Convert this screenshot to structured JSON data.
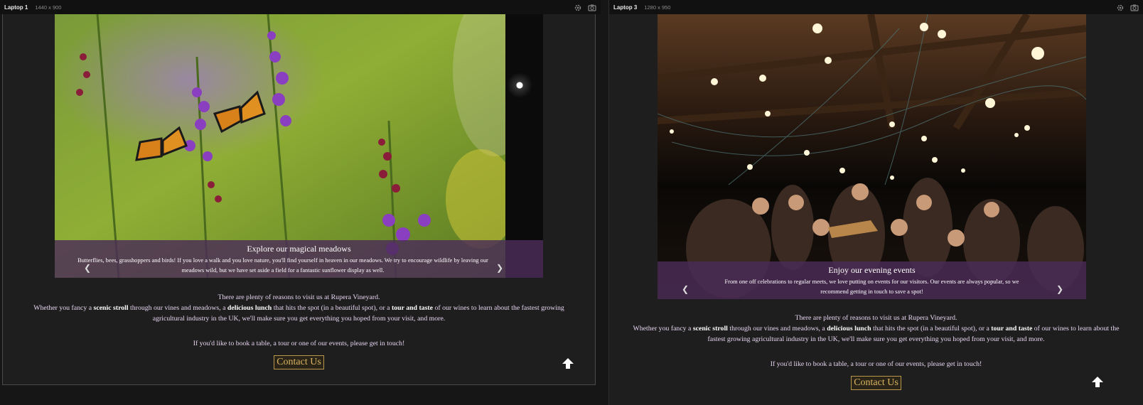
{
  "devices": [
    {
      "name": "Laptop 1",
      "size": "1440 x 900",
      "slide": {
        "title": "Explore our magical meadows",
        "text": "Butterflies, bees, grasshoppers and birds! If you love a walk and you love nature, you'll find yourself in heaven in our meadows. We try to encourage wildlife by leaving our meadows wild, but we have set aside a field for a fantastic sunflower display as well."
      }
    },
    {
      "name": "Laptop 3",
      "size": "1280 x 950",
      "slide": {
        "title": "Enjoy our evening events",
        "text": "From one off celebrations to regular meets, we love putting on events for our visitors. Our events are always popular, so we recommend getting in touch to save a spot!"
      }
    }
  ],
  "content": {
    "lead": "There are plenty of reasons to visit us at Rupera Vineyard.",
    "intro_1": "Whether you fancy a ",
    "bold_1": "scenic stroll",
    "intro_2": " through our vines and meadows, a ",
    "bold_2": "delicious lunch",
    "intro_3": " that hits the spot (in a beautiful spot), or a ",
    "bold_3": "tour and taste",
    "intro_4": " of our wines to learn about the fastest growing agricultural industry in the UK, we'll make sure you get everything you hoped from your visit, and more.",
    "booking": "If you'd like to book a table, a tour or one of our events, please get in touch!",
    "contact_label": "Contact Us"
  },
  "icons": {
    "settings": "gear-icon",
    "screenshot": "camera-icon",
    "prev": "chevron-left-icon",
    "next": "chevron-right-icon",
    "back_to_top": "arrow-up-icon"
  },
  "colors": {
    "caption_bg": "#4a2c58",
    "body_text": "#e8d6f2",
    "contact_border": "#b8964a",
    "contact_text": "#d9b560",
    "page_bg": "#1e1e1e"
  }
}
